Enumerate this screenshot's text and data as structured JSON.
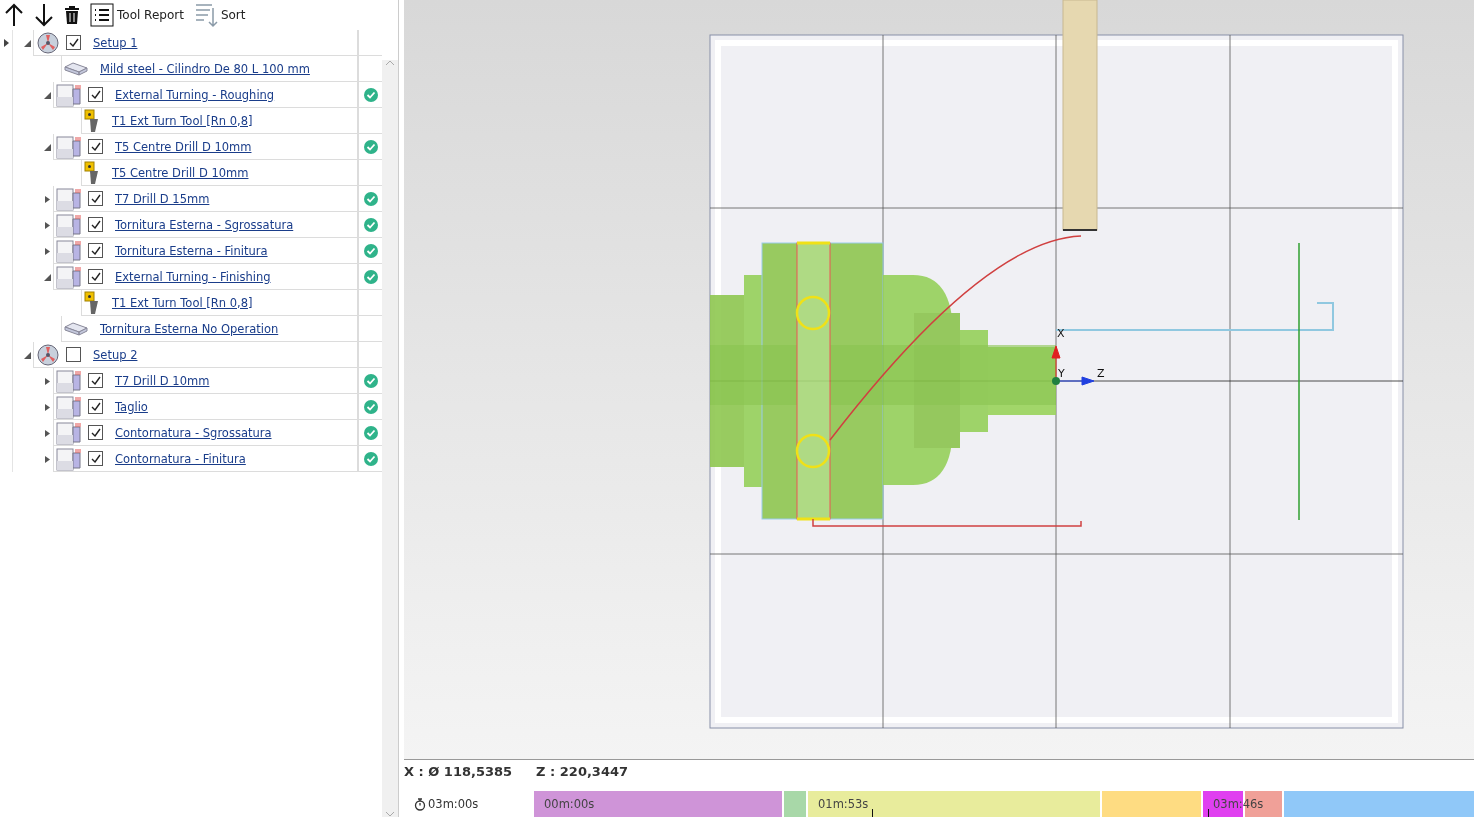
{
  "toolbar": {
    "buttons": [
      {
        "kind": "up"
      },
      {
        "kind": "down"
      },
      {
        "kind": "delete"
      },
      {
        "kind": "report",
        "label": "Tool Report"
      },
      {
        "kind": "sort",
        "label": "Sort"
      }
    ]
  },
  "tree": [
    {
      "kind": "setup",
      "label": "Setup 1",
      "checked": true,
      "expanded": true,
      "children": [
        {
          "kind": "stock",
          "label": "Mild steel - Cilindro De 80 L 100 mm"
        },
        {
          "kind": "operation",
          "label": "External Turning - Roughing",
          "checked": true,
          "expanded": true,
          "done": true,
          "children": [
            {
              "kind": "tool",
              "label": "T1 Ext Turn Tool  [Rn 0,8]"
            }
          ]
        },
        {
          "kind": "operation",
          "label": "T5 Centre Drill D 10mm",
          "checked": true,
          "expanded": true,
          "done": true,
          "children": [
            {
              "kind": "tool",
              "label": "T5 Centre Drill D 10mm"
            }
          ]
        },
        {
          "kind": "operation",
          "label": "T7 Drill  D 15mm",
          "checked": true,
          "expanded": false,
          "done": true
        },
        {
          "kind": "operation",
          "label": "Tornitura Esterna - Sgrossatura",
          "checked": true,
          "expanded": false,
          "done": true
        },
        {
          "kind": "operation",
          "label": "Tornitura Esterna - Finitura",
          "checked": true,
          "expanded": false,
          "done": true
        },
        {
          "kind": "operation",
          "label": "External Turning - Finishing",
          "checked": true,
          "expanded": true,
          "done": true,
          "children": [
            {
              "kind": "tool",
              "label": "T1 Ext Turn Tool  [Rn 0,8]"
            }
          ]
        },
        {
          "kind": "stock",
          "label": "Tornitura Esterna No Operation"
        }
      ]
    },
    {
      "kind": "setup",
      "label": "Setup 2",
      "checked": false,
      "expanded": true,
      "children": [
        {
          "kind": "operation",
          "label": "T7 Drill  D 10mm",
          "checked": true,
          "expanded": false,
          "done": true
        },
        {
          "kind": "operation",
          "label": "Taglio",
          "checked": true,
          "expanded": false,
          "done": true
        },
        {
          "kind": "operation",
          "label": "Contornatura - Sgrossatura",
          "checked": true,
          "expanded": false,
          "done": true
        },
        {
          "kind": "operation",
          "label": "Contornatura - Finitura",
          "checked": true,
          "expanded": false,
          "done": true
        }
      ]
    }
  ],
  "viewport": {
    "axes": [
      "X",
      "Y",
      "Z"
    ]
  },
  "coordinates": {
    "x": "X : Ø 118,5385",
    "z": "Z : 220,3447"
  },
  "timeline": {
    "total": "03m:00s",
    "segments": [
      {
        "color": "#cf94d8",
        "label": "00m:00s"
      },
      {
        "color": "#a8d8a8"
      },
      {
        "color": "#e8ec9c",
        "label": "01m:53s"
      },
      {
        "color": "#fedc82"
      },
      {
        "color": "#e040f0",
        "label": "03m:46s"
      },
      {
        "color": "#f0a098"
      },
      {
        "color": "#90c8f8"
      }
    ]
  }
}
